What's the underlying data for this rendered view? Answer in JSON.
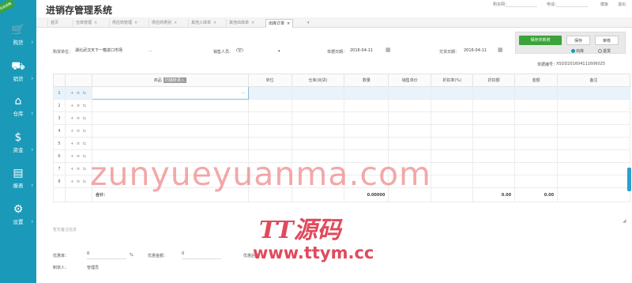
{
  "header": {
    "title": "进销存管理系统",
    "info": [
      "购买网：",
      "电话：",
      "模板",
      "退出"
    ]
  },
  "sidebar": {
    "badge": "系统前瞻",
    "items": [
      {
        "label": "购货",
        "icon": "cart-icon"
      },
      {
        "label": "销货",
        "icon": "sale-icon"
      },
      {
        "label": "仓库",
        "icon": "warehouse-icon"
      },
      {
        "label": "资金",
        "icon": "money-icon"
      },
      {
        "label": "报表",
        "icon": "report-icon"
      },
      {
        "label": "设置",
        "icon": "gear-icon"
      }
    ]
  },
  "tabs": [
    {
      "label": "首页",
      "close": ""
    },
    {
      "label": "仓库管理",
      "close": "×"
    },
    {
      "label": "供应商管理",
      "close": "×"
    },
    {
      "label": "供应商类别",
      "close": "×"
    },
    {
      "label": "其他入库单",
      "close": "×"
    },
    {
      "label": "其他出库单",
      "close": "×"
    },
    {
      "label": "出库订单",
      "close": "×",
      "active": true
    }
  ],
  "tab_more": "▾",
  "toolbar": {
    "save_new": "保存并新增",
    "save": "保存",
    "audit": "审核",
    "radio_out": "出库",
    "radio_return": "退货"
  },
  "form": {
    "customer_label": "购货单位：",
    "customer_value": "湖北武汉天下一箱进口市场",
    "customer_more": "···",
    "salesman_label": "销售人员：",
    "salesman_value": "(空)",
    "salesman_arrow": "▾",
    "bill_date_label": "单据日期：",
    "bill_date_value": "2016-04-11",
    "delivery_date_label": "交货日期：",
    "delivery_date_value": "2016-04-11",
    "bill_no_label": "单据编号：",
    "bill_no_value": "XSDD201604111606025"
  },
  "grid": {
    "headers": [
      "",
      "",
      "商品",
      "单位",
      "仓库(出货)",
      "数量",
      "销售单价",
      "折扣率(%)",
      "折扣额",
      "金额",
      "备注"
    ],
    "product_tag": "扫描枪录入",
    "ops": "+ ≡ ⇆",
    "cell_more": "···",
    "rows": [
      "1",
      "2",
      "3",
      "4",
      "5",
      "6",
      "7",
      "8"
    ],
    "total_label": "合计：",
    "total_qty": "0.00000",
    "total_discount": "0.00",
    "total_amount": "0.00"
  },
  "note_placeholder": "暂无备注信息",
  "footer": {
    "discount_rate_label": "优惠率：",
    "discount_rate_value": "0",
    "percent": "%",
    "discount_amount_label": "优惠金额：",
    "discount_amount_value": "0",
    "after_discount_label": "优惠后金",
    "creator_label": "制单人：",
    "creator_value": "管理员"
  },
  "watermark": {
    "line1": "zunyueyuanma.com",
    "line2": "TT源码",
    "line3": "www.ttym.cc"
  },
  "colors": {
    "sidebar": "#1a9ab8",
    "primary": "#3aa33a",
    "watermark": "#e04a5c"
  }
}
